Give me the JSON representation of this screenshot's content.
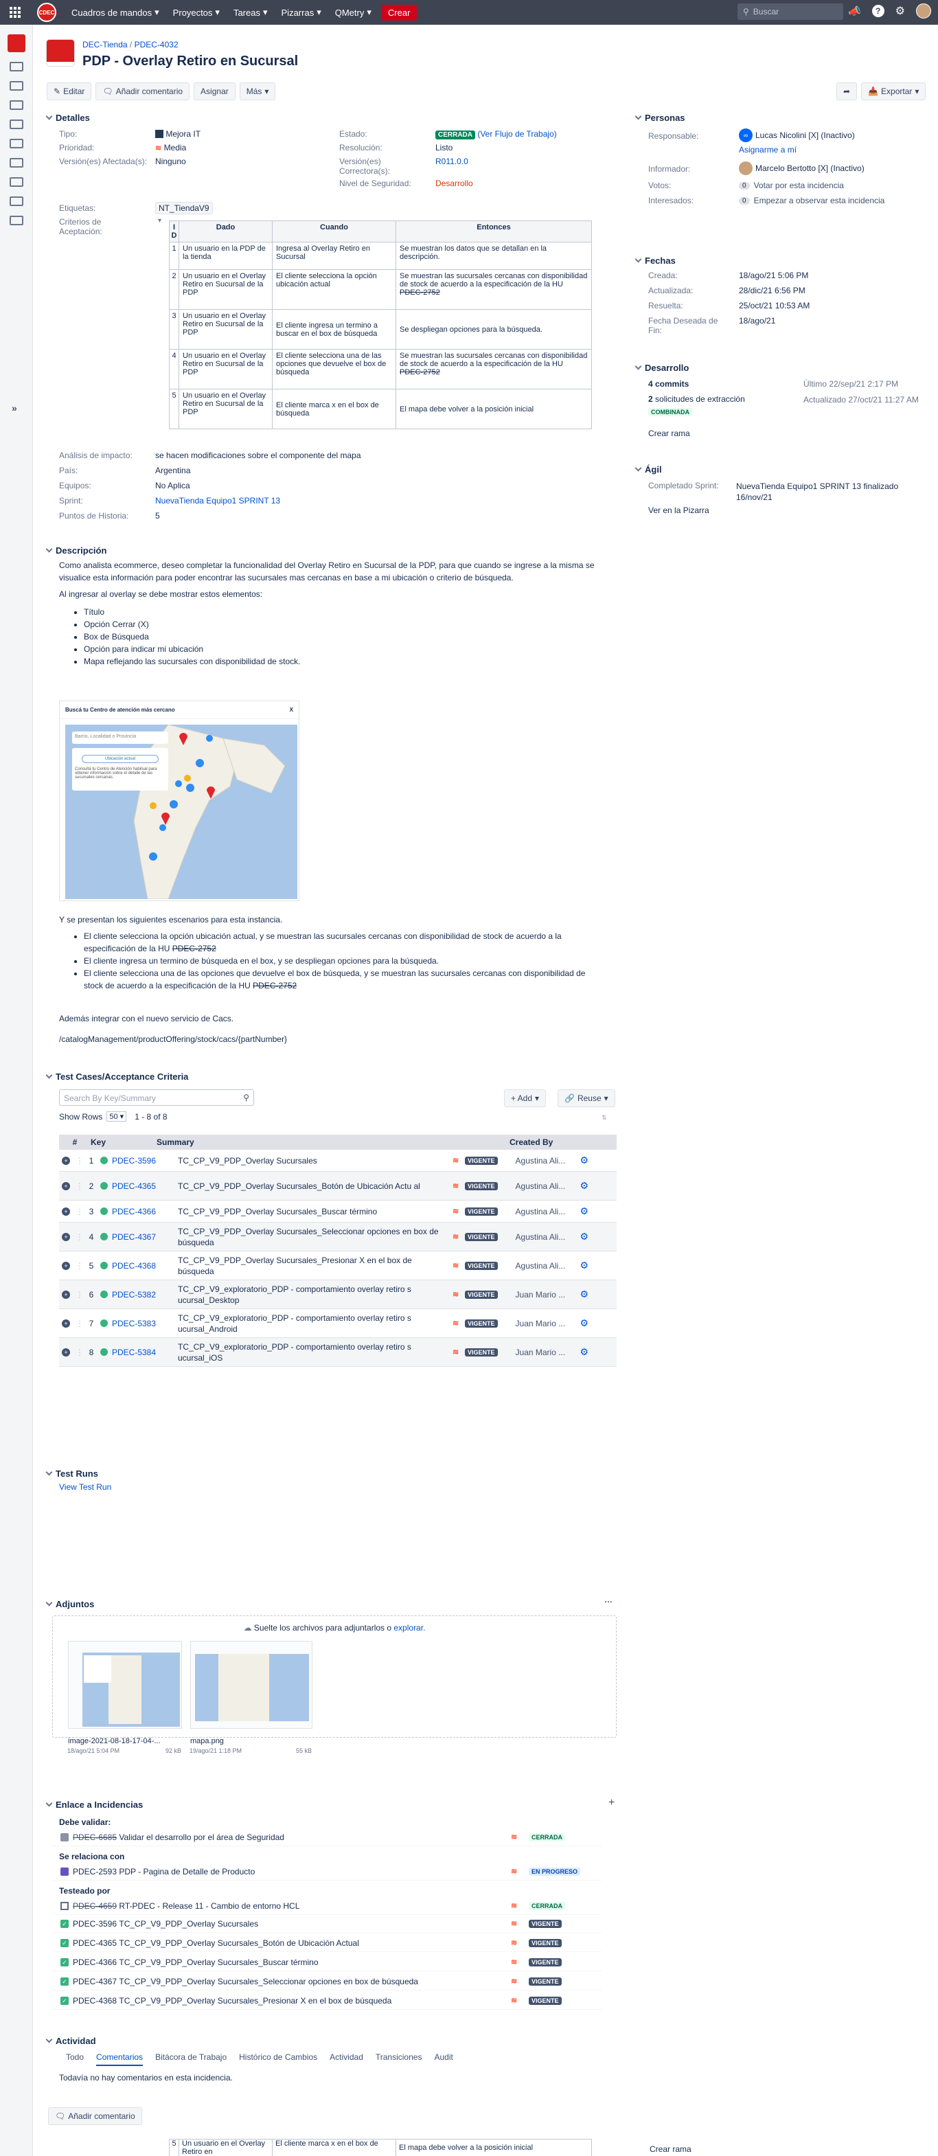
{
  "topbar": {
    "nav": [
      "Cuadros de mandos",
      "Proyectos",
      "Tareas",
      "Pizarras",
      "QMetry"
    ],
    "create": "Crear",
    "search_placeholder": "Buscar",
    "logo_text": "CDEC"
  },
  "breadcrumb": {
    "project": "DEC-Tienda",
    "issue": "PDEC-4032"
  },
  "title": "PDP - Overlay Retiro en Sucursal",
  "toolbar": {
    "edit": "Editar",
    "comment": "Añadir comentario",
    "assign": "Asignar",
    "more": "Más",
    "export": "Exportar"
  },
  "details": {
    "heading": "Detalles",
    "tipo_l": "Tipo:",
    "tipo_v": "Mejora IT",
    "prioridad_l": "Prioridad:",
    "prioridad_v": "Media",
    "version_l": "Versión(es) Afectada(s):",
    "version_v": "Ninguno",
    "estado_l": "Estado:",
    "estado_v": "CERRADA",
    "estado_flow": "(Ver Flujo de Trabajo)",
    "resolucion_l": "Resolución:",
    "resolucion_v": "Listo",
    "correctora_l": "Versión(es) Correctora(s):",
    "correctora_v": "R011.0.0",
    "seguridad_l": "Nivel de Seguridad:",
    "seguridad_v": "Desarrollo",
    "etiquetas_l": "Etiquetas:",
    "etiquetas_v": "NT_TiendaV9",
    "criterios_l": "Criterios de Aceptación:",
    "criteria_headers": [
      "I D",
      "Dado",
      "Cuando",
      "Entonces"
    ],
    "criteria": [
      {
        "id": "1",
        "dado": "Un usuario en la PDP de la tienda",
        "cuando": "Ingresa al Overlay Retiro en Sucursal",
        "entonces": " Se muestran los datos que se detallan en la descripción."
      },
      {
        "id": "2",
        "dado": "Un usuario en el Overlay Retiro en Sucursal  de la PDP",
        "cuando": "El cliente selecciona la opción ubicación actual",
        "entonces": "Se muestran las sucursales cercanas con disponibilidad de stock de acuerdo a la especificación de la HU ",
        "ref": "PDEC-2752"
      },
      {
        "id": "3",
        "dado": "Un usuario en el Overlay Retiro en Sucursal  de la PDP",
        "cuando": "El cliente ingresa un termino a buscar en el box de búsqueda",
        "entonces": "Se despliegan opciones para la búsqueda."
      },
      {
        "id": "4",
        "dado": "Un usuario en el Overlay Retiro en Sucursal  de la PDP",
        "cuando": "El cliente selecciona una de las opciones que devuelve el box de búsqueda",
        "entonces": "Se muestran las sucursales cercanas con disponibilidad de stock de acuerdo a la especificación de la HU ",
        "ref": "PDEC-2752"
      },
      {
        "id": "5",
        "dado": "Un usuario en el Overlay Retiro en Sucursal  de la PDP",
        "cuando": "El cliente marca x en el box de búsqueda",
        "entonces": "El mapa debe volver a la posición inicial"
      }
    ],
    "analisis_l": "Análisis de impacto:",
    "analisis_v": "se hacen modificaciones sobre el componente del mapa",
    "pais_l": "País:",
    "pais_v": "Argentina",
    "equipos_l": "Equipos:",
    "equipos_v": "No Aplica",
    "sprint_l": "Sprint:",
    "sprint_v": "NuevaTienda Equipo1 SPRINT 13",
    "puntos_l": "Puntos de Historia:",
    "puntos_v": "5"
  },
  "descripcion": {
    "heading": "Descripción",
    "p1": "Como analista ecommerce, deseo completar la funcionalidad del Overlay Retiro en Sucursal de la PDP, para que cuando se ingrese a la misma se visualice esta información para poder encontrar las sucursales mas cercanas en base a mi ubicación o criterio de búsqueda.",
    "p2": "Al ingresar al overlay se debe mostrar estos elementos:",
    "items": [
      "Título",
      "Opción Cerrar (X)",
      "Box de Búsqueda",
      "Opción para indicar mi ubicación",
      "Mapa reflejando las sucursales con disponibilidad de stock."
    ],
    "img_title": "Buscá tu Centro de atención más cercano",
    "img_close": "X",
    "img_search": "Barrio, Localidad o Provincia",
    "img_location": "Ubicación actual",
    "img_note": "Consultá tu Centro de Atención habitual para obtener información sobre el detalle de las sucursales cercanas.",
    "p3": "Y se presentan los siguientes escenarios para esta instancia.",
    "scen1": "El cliente selecciona la opción ubicación actual, y se muestran las sucursales cercanas con disponibilidad de stock de acuerdo a la especificación de la HU ",
    "scen2": "El cliente ingresa un termino de búsqueda en el box, y se despliegan opciones para la búsqueda.",
    "scen3": "El cliente selecciona una de las opciones que devuelve el box de búsqueda, y se muestran las sucursales cercanas con disponibilidad de stock de acuerdo a la especificación de la HU ",
    "ref": "PDEC-2752",
    "p4": "Además integrar con el nuevo servicio de Cacs.",
    "p5": "/catalogManagement/productOffering/stock/cacs/{partNumber}"
  },
  "testcases": {
    "heading": "Test Cases/Acceptance Criteria",
    "search_placeholder": "Search By Key/Summary",
    "add": "+ Add",
    "reuse": "Reuse",
    "showrows": "Show Rows",
    "rows_value": "50",
    "range": "1 - 8 of 8",
    "headers": [
      "#",
      "Key",
      "Summary",
      "Created By"
    ],
    "rows": [
      {
        "n": "1",
        "key": "PDEC-3596",
        "summary": "TC_CP_V9_PDP_Overlay Sucursales",
        "status": "VIGENTE",
        "by": "Agustina Ali..."
      },
      {
        "n": "2",
        "key": "PDEC-4365",
        "summary": "TC_CP_V9_PDP_Overlay Sucursales_Botón de Ubicación Actu al",
        "status": "VIGENTE",
        "by": "Agustina Ali..."
      },
      {
        "n": "3",
        "key": "PDEC-4366",
        "summary": "TC_CP_V9_PDP_Overlay Sucursales_Buscar término",
        "status": "VIGENTE",
        "by": "Agustina Ali..."
      },
      {
        "n": "4",
        "key": "PDEC-4367",
        "summary": "TC_CP_V9_PDP_Overlay Sucursales_Seleccionar opciones en box de búsqueda",
        "status": "VIGENTE",
        "by": "Agustina Ali..."
      },
      {
        "n": "5",
        "key": "PDEC-4368",
        "summary": "TC_CP_V9_PDP_Overlay Sucursales_Presionar X en el box de búsqueda",
        "status": "VIGENTE",
        "by": "Agustina Ali..."
      },
      {
        "n": "6",
        "key": "PDEC-5382",
        "summary": "TC_CP_V9_exploratorio_PDP - comportamiento overlay retiro s ucursal_Desktop",
        "status": "VIGENTE",
        "by": "Juan Mario ..."
      },
      {
        "n": "7",
        "key": "PDEC-5383",
        "summary": "TC_CP_V9_exploratorio_PDP - comportamiento overlay retiro s ucursal_Android",
        "status": "VIGENTE",
        "by": "Juan Mario ..."
      },
      {
        "n": "8",
        "key": "PDEC-5384",
        "summary": "TC_CP_V9_exploratorio_PDP - comportamiento overlay retiro s ucursal_iOS",
        "status": "VIGENTE",
        "by": "Juan Mario ..."
      }
    ]
  },
  "testruns": {
    "heading": "Test Runs",
    "link": "View Test Run"
  },
  "adjuntos": {
    "heading": "Adjuntos",
    "drop": "Suelte los archivos para adjuntarlos o ",
    "drop_link": "explorar.",
    "files": [
      {
        "name": "image-2021-08-18-17-04-...",
        "date": "18/ago/21 5:04 PM",
        "size": "92 kB"
      },
      {
        "name": "mapa.png",
        "date": "19/ago/21 1:18 PM",
        "size": "55 kB"
      }
    ]
  },
  "enlaces": {
    "heading": "Enlace a Incidencias",
    "g1": "Debe validar:",
    "l1": {
      "key": "PDEC-6685",
      "text": "Validar el desarrollo por el área de Seguridad",
      "status": "CERRADA"
    },
    "g2": "Se relaciona con",
    "l2": {
      "key": "PDEC-2593",
      "text": "PDP - Pagina de Detalle de Producto",
      "status": "EN PROGRESO"
    },
    "g3": "Testeado por",
    "l3": {
      "key": "PDEC-4659",
      "text": "RT-PDEC - Release 11 - Cambio de entorno HCL",
      "status": "CERRADA"
    },
    "tested": [
      {
        "key": "PDEC-3596",
        "text": "TC_CP_V9_PDP_Overlay Sucursales",
        "status": "VIGENTE"
      },
      {
        "key": "PDEC-4365",
        "text": "TC_CP_V9_PDP_Overlay Sucursales_Botón de Ubicación Actual",
        "status": "VIGENTE"
      },
      {
        "key": "PDEC-4366",
        "text": "TC_CP_V9_PDP_Overlay Sucursales_Buscar término",
        "status": "VIGENTE"
      },
      {
        "key": "PDEC-4367",
        "text": "TC_CP_V9_PDP_Overlay Sucursales_Seleccionar opciones en box de búsqueda",
        "status": "VIGENTE"
      },
      {
        "key": "PDEC-4368",
        "text": "TC_CP_V9_PDP_Overlay Sucursales_Presionar X en el box de búsqueda",
        "status": "VIGENTE"
      }
    ]
  },
  "actividad": {
    "heading": "Actividad",
    "tabs": [
      "Todo",
      "Comentarios",
      "Bitácora de Trabajo",
      "Histórico de Cambios",
      "Actividad",
      "Transiciones",
      "Audit"
    ],
    "empty": "Todavía no hay comentarios en esta incidencia.",
    "add_comment": "Añadir comentario"
  },
  "personas": {
    "heading": "Personas",
    "resp_l": "Responsable:",
    "resp_v": "Lucas Nicolini [X] (Inactivo)",
    "assign_me": "Asignarme a mí",
    "inf_l": "Informador:",
    "inf_v": "Marcelo Bertotto [X] (Inactivo)",
    "votos_l": "Votos:",
    "votos_n": "0",
    "votos_v": "Votar por esta incidencia",
    "int_l": "Interesados:",
    "int_n": "0",
    "int_v": "Empezar a observar esta incidencia"
  },
  "fechas": {
    "heading": "Fechas",
    "creada_l": "Creada:",
    "creada_v": "18/ago/21 5:06 PM",
    "act_l": "Actualizada:",
    "act_v": "28/dic/21 6:56 PM",
    "res_l": "Resuelta:",
    "res_v": "25/oct/21 10:53 AM",
    "fin_l": "Fecha Deseada de Fin:",
    "fin_v": "18/ago/21"
  },
  "desarrollo": {
    "heading": "Desarrollo",
    "commits": "4 commits",
    "commits_info": "Último 22/sep/21 2:17 PM",
    "pr_n": "2",
    "pr": "solicitudes de extracción",
    "pr_info": "Actualizado 27/oct/21 11:27 AM",
    "pr_status": "COMBINADA",
    "branch": "Crear rama"
  },
  "agil": {
    "heading": "Ágil",
    "comp_l": "Completado Sprint:",
    "comp_v": "NuevaTienda Equipo1 SPRINT 13 finalizado 16/nov/21",
    "board": "Ver en la Pizarra"
  },
  "ghost": {
    "dado": "Un usuario en el Overlay Retiro en",
    "cuando": "El cliente marca x en el box de",
    "entonces": "El mapa debe volver a la posición inicial",
    "n": "5",
    "branch": "Crear rama"
  }
}
